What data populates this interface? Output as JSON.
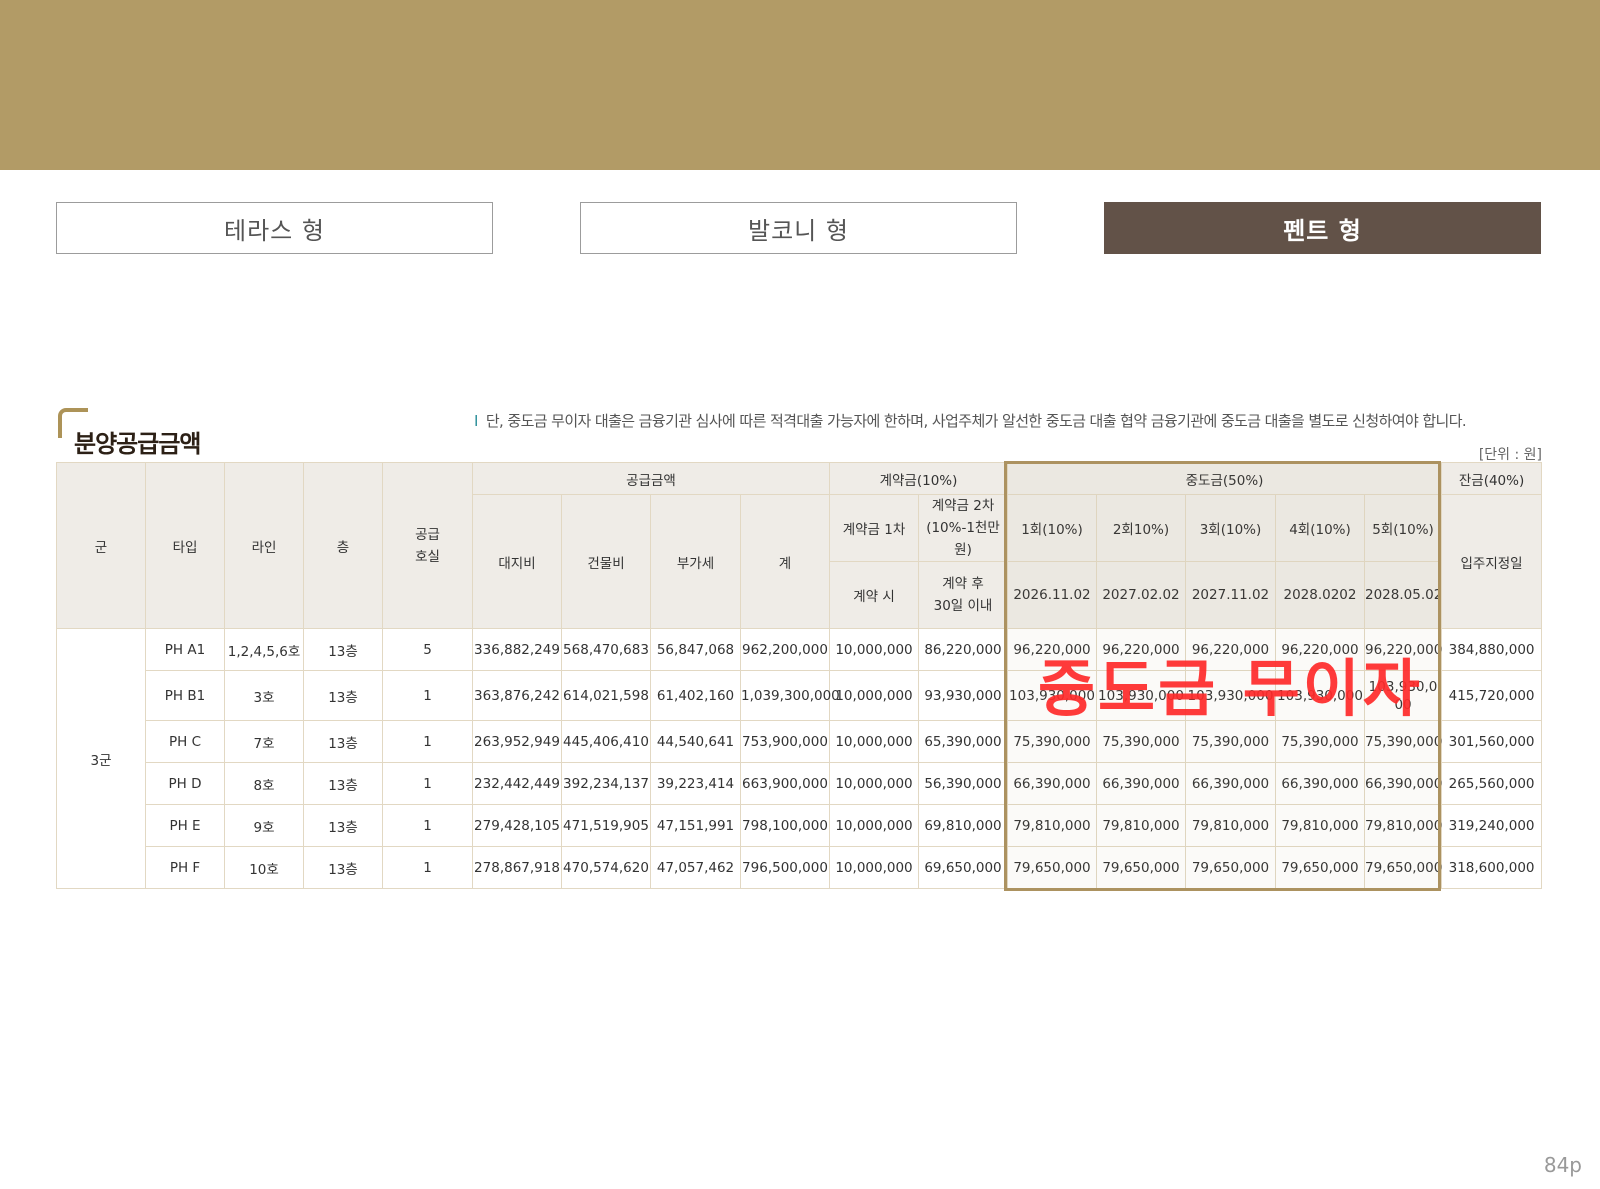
{
  "tabs": [
    "테라스 형",
    "발코니 형",
    "펜트 형"
  ],
  "section_title": "분양공급금액",
  "note_bar": "I",
  "note": "단, 중도금 무이자 대출은 금융기관 심사에 따른 적격대출 가능자에 한하며, 사업주체가 알선한 중도금 대출 협약 금융기관에 중도금 대출을 별도로 신청하여야 합니다.",
  "unit": "[단위 : 원]",
  "headers": {
    "gun": "군",
    "type": "타입",
    "line": "라인",
    "floor": "층",
    "supply_unit_1": "공급",
    "supply_unit_2": "호실",
    "supply_price": "공급금액",
    "land": "대지비",
    "building": "건물비",
    "vat": "부가세",
    "total": "계",
    "deposit": "계약금(10%)",
    "deposit1": "계약금 1차",
    "deposit2_1": "계약금 2차",
    "deposit2_2": "(10%-1천만원)",
    "deposit1_when": "계약 시",
    "deposit2_when_1": "계약 후",
    "deposit2_when_2": "30일 이내",
    "middle": "중도금(50%)",
    "m1": "1회(10%)",
    "m2": "2회10%)",
    "m3": "3회(10%)",
    "m4": "4회(10%)",
    "m5": "5회(10%)",
    "d1": "2026.11.02",
    "d2": "2027.02.02",
    "d3": "2027.11.02",
    "d4": "2028.0202",
    "d5": "2028.05.02",
    "balance": "잔금(40%)",
    "balance_when": "입주지정일"
  },
  "group": "3군",
  "rows": [
    {
      "type": "PH A1",
      "line": "1,2,4,5,6호",
      "floor": "13층",
      "units": "5",
      "land": "336,882,249",
      "building": "568,470,683",
      "vat": "56,847,068",
      "total": "962,200,000",
      "dep1": "10,000,000",
      "dep2": "86,220,000",
      "m1": "96,220,000",
      "m2": "96,220,000",
      "m3": "96,220,000",
      "m4": "96,220,000",
      "m5": "96,220,000",
      "balance": "384,880,000"
    },
    {
      "type": "PH B1",
      "line": "3호",
      "floor": "13층",
      "units": "1",
      "land": "363,876,242",
      "building": "614,021,598",
      "vat": "61,402,160",
      "total": "1,039,300,000",
      "dep1": "10,000,000",
      "dep2": "93,930,000",
      "m1": "103,930,000",
      "m2": "103,930,000",
      "m3": "103,930,000",
      "m4": "103,930,000",
      "m5": "103,930,000",
      "balance": "415,720,000"
    },
    {
      "type": "PH C",
      "line": "7호",
      "floor": "13층",
      "units": "1",
      "land": "263,952,949",
      "building": "445,406,410",
      "vat": "44,540,641",
      "total": "753,900,000",
      "dep1": "10,000,000",
      "dep2": "65,390,000",
      "m1": "75,390,000",
      "m2": "75,390,000",
      "m3": "75,390,000",
      "m4": "75,390,000",
      "m5": "75,390,000",
      "balance": "301,560,000"
    },
    {
      "type": "PH D",
      "line": "8호",
      "floor": "13층",
      "units": "1",
      "land": "232,442,449",
      "building": "392,234,137",
      "vat": "39,223,414",
      "total": "663,900,000",
      "dep1": "10,000,000",
      "dep2": "56,390,000",
      "m1": "66,390,000",
      "m2": "66,390,000",
      "m3": "66,390,000",
      "m4": "66,390,000",
      "m5": "66,390,000",
      "balance": "265,560,000"
    },
    {
      "type": "PH E",
      "line": "9호",
      "floor": "13층",
      "units": "1",
      "land": "279,428,105",
      "building": "471,519,905",
      "vat": "47,151,991",
      "total": "798,100,000",
      "dep1": "10,000,000",
      "dep2": "69,810,000",
      "m1": "79,810,000",
      "m2": "79,810,000",
      "m3": "79,810,000",
      "m4": "79,810,000",
      "m5": "79,810,000",
      "balance": "319,240,000"
    },
    {
      "type": "PH F",
      "line": "10호",
      "floor": "13층",
      "units": "1",
      "land": "278,867,918",
      "building": "470,574,620",
      "vat": "47,057,462",
      "total": "796,500,000",
      "dep1": "10,000,000",
      "dep2": "69,650,000",
      "m1": "79,650,000",
      "m2": "79,650,000",
      "m3": "79,650,000",
      "m4": "79,650,000",
      "m5": "79,650,000",
      "balance": "318,600,000"
    }
  ],
  "overlay": "중도금 무이자",
  "page_number": "84p"
}
